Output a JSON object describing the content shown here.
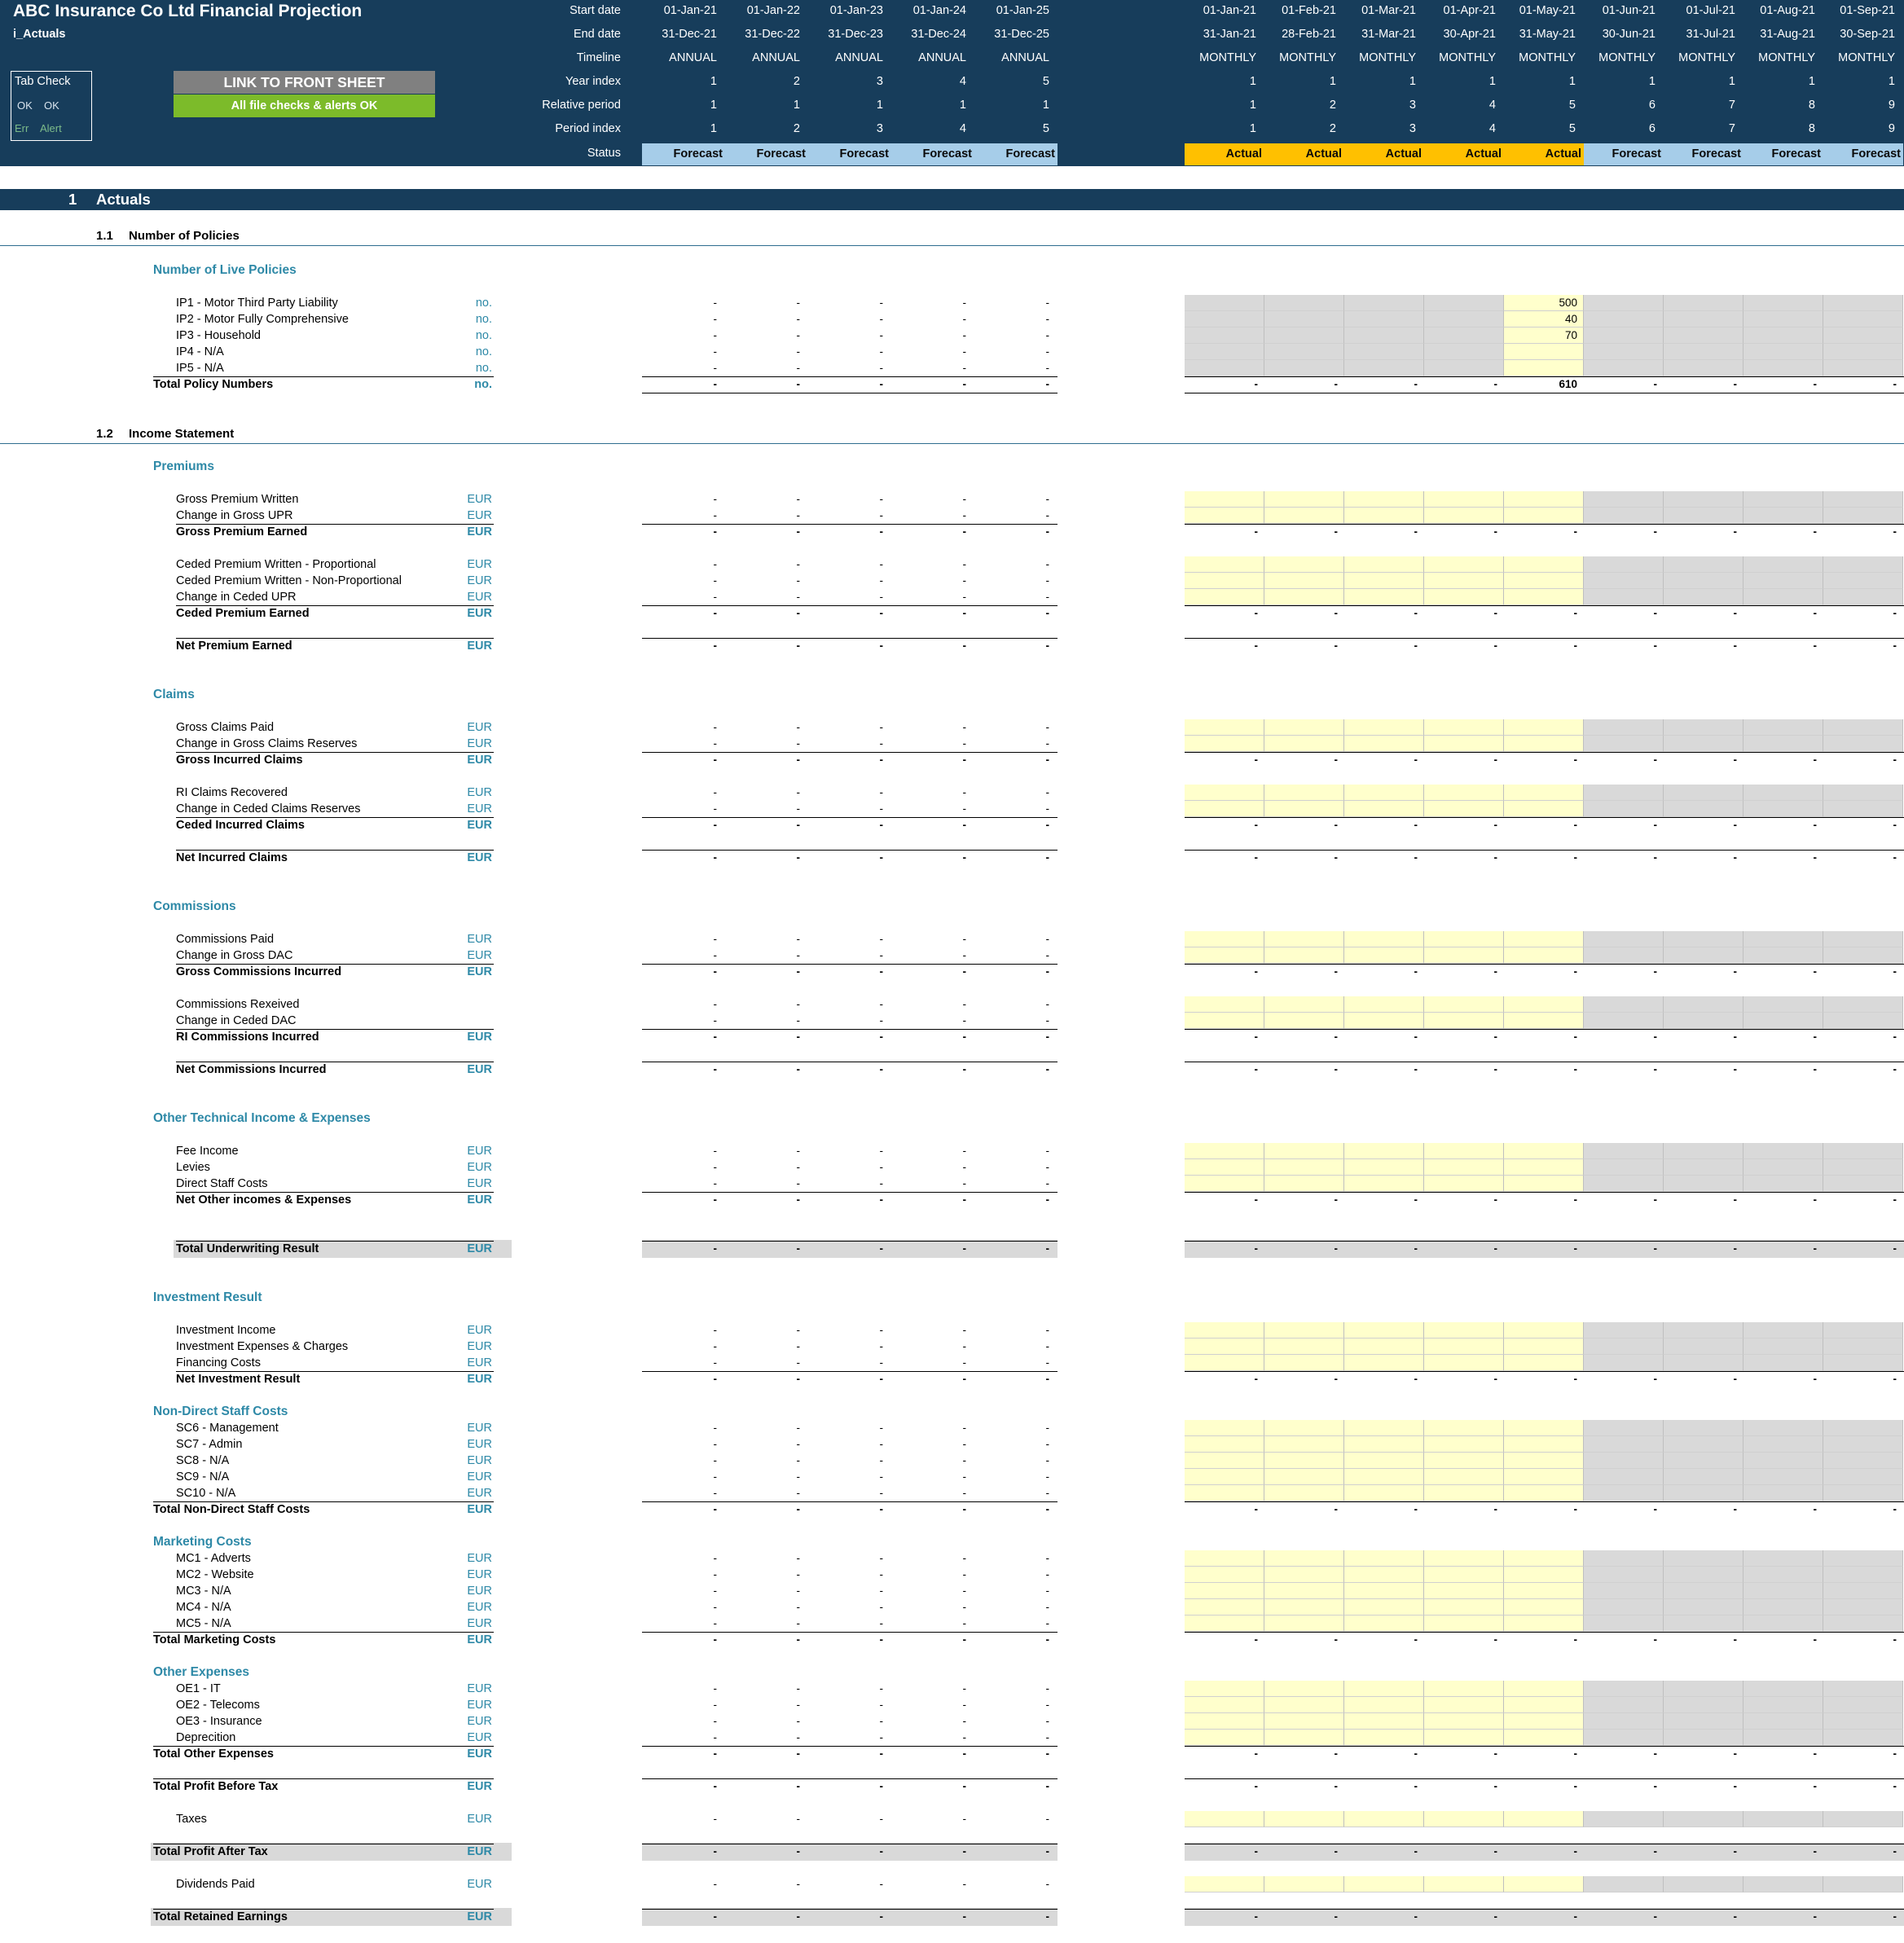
{
  "header": {
    "title": "ABC Insurance Co Ltd Financial Projection",
    "tab_name": "i_Actuals",
    "row_labels": [
      "Start date",
      "End date",
      "Timeline",
      "Year index",
      "Relative period",
      "Period index",
      "Status"
    ],
    "tab_check": {
      "title": "Tab Check",
      "ok_1": "OK",
      "ok_2": "OK",
      "err": "Err",
      "alert": "Alert"
    },
    "link_button": "LINK TO FRONT SHEET",
    "check_banner": "All file checks & alerts OK",
    "annual_columns": [
      {
        "start": "01-Jan-21",
        "end": "31-Dec-21",
        "timeline": "ANNUAL",
        "year": "1",
        "rel": "1",
        "period": "1",
        "status": "Forecast"
      },
      {
        "start": "01-Jan-22",
        "end": "31-Dec-22",
        "timeline": "ANNUAL",
        "year": "2",
        "rel": "1",
        "period": "2",
        "status": "Forecast"
      },
      {
        "start": "01-Jan-23",
        "end": "31-Dec-23",
        "timeline": "ANNUAL",
        "year": "3",
        "rel": "1",
        "period": "3",
        "status": "Forecast"
      },
      {
        "start": "01-Jan-24",
        "end": "31-Dec-24",
        "timeline": "ANNUAL",
        "year": "4",
        "rel": "1",
        "period": "4",
        "status": "Forecast"
      },
      {
        "start": "01-Jan-25",
        "end": "31-Dec-25",
        "timeline": "ANNUAL",
        "year": "5",
        "rel": "1",
        "period": "5",
        "status": "Forecast"
      }
    ],
    "monthly_columns": [
      {
        "start": "01-Jan-21",
        "end": "31-Jan-21",
        "timeline": "MONTHLY",
        "year": "1",
        "rel": "1",
        "period": "1",
        "status": "Actual"
      },
      {
        "start": "01-Feb-21",
        "end": "28-Feb-21",
        "timeline": "MONTHLY",
        "year": "1",
        "rel": "2",
        "period": "2",
        "status": "Actual"
      },
      {
        "start": "01-Mar-21",
        "end": "31-Mar-21",
        "timeline": "MONTHLY",
        "year": "1",
        "rel": "3",
        "period": "3",
        "status": "Actual"
      },
      {
        "start": "01-Apr-21",
        "end": "30-Apr-21",
        "timeline": "MONTHLY",
        "year": "1",
        "rel": "4",
        "period": "4",
        "status": "Actual"
      },
      {
        "start": "01-May-21",
        "end": "31-May-21",
        "timeline": "MONTHLY",
        "year": "1",
        "rel": "5",
        "period": "5",
        "status": "Actual"
      },
      {
        "start": "01-Jun-21",
        "end": "30-Jun-21",
        "timeline": "MONTHLY",
        "year": "1",
        "rel": "6",
        "period": "6",
        "status": "Forecast"
      },
      {
        "start": "01-Jul-21",
        "end": "31-Jul-21",
        "timeline": "MONTHLY",
        "year": "1",
        "rel": "7",
        "period": "7",
        "status": "Forecast"
      },
      {
        "start": "01-Aug-21",
        "end": "31-Aug-21",
        "timeline": "MONTHLY",
        "year": "1",
        "rel": "8",
        "period": "8",
        "status": "Forecast"
      },
      {
        "start": "01-Sep-21",
        "end": "30-Sep-21",
        "timeline": "MONTHLY",
        "year": "1",
        "rel": "9",
        "period": "9",
        "status": "Forecast"
      }
    ]
  },
  "section_1": {
    "number": "1",
    "title": "Actuals"
  },
  "subsection_1_1": {
    "number": "1.1",
    "title": "Number of Policies"
  },
  "subsection_1_2": {
    "number": "1.2",
    "title": "Income Statement"
  },
  "dash": "-",
  "rows": [
    {
      "kind": "group",
      "label": "Number of Live Policies"
    },
    {
      "kind": "input",
      "label": "IP1 - Motor Third Party Liability",
      "unit": "no.",
      "input": "grey",
      "values": [
        "",
        "",
        "",
        "",
        "500",
        "",
        "",
        "",
        ""
      ]
    },
    {
      "kind": "input",
      "label": "IP2 - Motor Fully Comprehensive",
      "unit": "no.",
      "input": "grey",
      "values": [
        "",
        "",
        "",
        "",
        "40",
        "",
        "",
        "",
        ""
      ]
    },
    {
      "kind": "input",
      "label": "IP3 - Household",
      "unit": "no.",
      "input": "grey",
      "values": [
        "",
        "",
        "",
        "",
        "70",
        "",
        "",
        "",
        ""
      ]
    },
    {
      "kind": "input",
      "label": "IP4 - N/A",
      "unit": "no.",
      "input": "grey",
      "values": [
        "",
        "",
        "",
        "",
        "",
        "",
        "",
        "",
        ""
      ]
    },
    {
      "kind": "input",
      "label": "IP5 - N/A",
      "unit": "no.",
      "input": "grey",
      "values": [
        "",
        "",
        "",
        "",
        "",
        "",
        "",
        "",
        ""
      ]
    },
    {
      "kind": "total",
      "label": "Total Policy Numbers",
      "unit": "no.",
      "values": [
        "-",
        "-",
        "-",
        "-",
        "610",
        "-",
        "-",
        "-",
        "-"
      ]
    },
    {
      "kind": "subsection",
      "ref": "1.2"
    },
    {
      "kind": "group",
      "label": "Premiums"
    },
    {
      "kind": "input",
      "label": "Gross Premium Written",
      "unit": "EUR"
    },
    {
      "kind": "input",
      "label": "Change in Gross UPR",
      "unit": "EUR"
    },
    {
      "kind": "subtotal",
      "label": "Gross Premium Earned",
      "unit": "EUR"
    },
    {
      "kind": "input",
      "label": "Ceded Premium Written - Proportional",
      "unit": "EUR"
    },
    {
      "kind": "input",
      "label": "Ceded Premium Written - Non-Proportional",
      "unit": "EUR"
    },
    {
      "kind": "input",
      "label": "Change in Ceded UPR",
      "unit": "EUR"
    },
    {
      "kind": "subtotal",
      "label": "Ceded Premium Earned",
      "unit": "EUR"
    },
    {
      "kind": "subtotal",
      "label": "Net Premium Earned",
      "unit": "EUR"
    },
    {
      "kind": "group",
      "label": "Claims"
    },
    {
      "kind": "input",
      "label": "Gross Claims Paid",
      "unit": "EUR"
    },
    {
      "kind": "input",
      "label": "Change in Gross Claims Reserves",
      "unit": "EUR"
    },
    {
      "kind": "subtotal",
      "label": "Gross Incurred Claims",
      "unit": "EUR"
    },
    {
      "kind": "input",
      "label": "RI Claims Recovered",
      "unit": "EUR"
    },
    {
      "kind": "input",
      "label": "Change in Ceded Claims Reserves",
      "unit": "EUR"
    },
    {
      "kind": "subtotal",
      "label": "Ceded Incurred Claims",
      "unit": "EUR"
    },
    {
      "kind": "subtotal",
      "label": "Net Incurred Claims",
      "unit": "EUR"
    },
    {
      "kind": "group",
      "label": "Commissions"
    },
    {
      "kind": "input",
      "label": "Commissions Paid",
      "unit": "EUR"
    },
    {
      "kind": "input",
      "label": "Change in Gross DAC",
      "unit": "EUR"
    },
    {
      "kind": "subtotal",
      "label": "Gross Commissions Incurred",
      "unit": "EUR"
    },
    {
      "kind": "input",
      "label": "Commissions Rexeived",
      "unit": ""
    },
    {
      "kind": "input",
      "label": "Change in Ceded DAC",
      "unit": ""
    },
    {
      "kind": "subtotal",
      "label": "RI Commissions Incurred",
      "unit": "EUR"
    },
    {
      "kind": "subtotal",
      "label": "Net Commissions Incurred",
      "unit": "EUR"
    },
    {
      "kind": "group",
      "label": "Other Technical Income & Expenses"
    },
    {
      "kind": "input",
      "label": "Fee Income",
      "unit": "EUR"
    },
    {
      "kind": "input",
      "label": "Levies",
      "unit": "EUR"
    },
    {
      "kind": "input",
      "label": "Direct Staff Costs",
      "unit": "EUR"
    },
    {
      "kind": "subtotal",
      "label": "Net Other incomes & Expenses",
      "unit": "EUR"
    },
    {
      "kind": "grand",
      "label": "Total Underwriting Result",
      "unit": "EUR"
    },
    {
      "kind": "group",
      "label": "Investment Result"
    },
    {
      "kind": "input",
      "label": "Investment Income",
      "unit": "EUR"
    },
    {
      "kind": "input",
      "label": "Investment Expenses & Charges",
      "unit": "EUR"
    },
    {
      "kind": "input",
      "label": "Financing Costs",
      "unit": "EUR"
    },
    {
      "kind": "subtotal",
      "label": "Net Investment Result",
      "unit": "EUR"
    },
    {
      "kind": "group",
      "label": "Non-Direct Staff Costs"
    },
    {
      "kind": "input",
      "label": "SC6 - Management",
      "unit": "EUR"
    },
    {
      "kind": "input",
      "label": "SC7 - Admin",
      "unit": "EUR"
    },
    {
      "kind": "input",
      "label": "SC8 - N/A",
      "unit": "EUR"
    },
    {
      "kind": "input",
      "label": "SC9 - N/A",
      "unit": "EUR"
    },
    {
      "kind": "input",
      "label": "SC10 - N/A",
      "unit": "EUR"
    },
    {
      "kind": "total",
      "label": "Total Non-Direct Staff Costs",
      "unit": "EUR"
    },
    {
      "kind": "group",
      "label": "Marketing Costs"
    },
    {
      "kind": "input",
      "label": "MC1 - Adverts",
      "unit": "EUR"
    },
    {
      "kind": "input",
      "label": "MC2 - Website",
      "unit": "EUR"
    },
    {
      "kind": "input",
      "label": "MC3 - N/A",
      "unit": "EUR"
    },
    {
      "kind": "input",
      "label": "MC4 - N/A",
      "unit": "EUR"
    },
    {
      "kind": "input",
      "label": "MC5 - N/A",
      "unit": "EUR"
    },
    {
      "kind": "total",
      "label": "Total Marketing Costs",
      "unit": "EUR"
    },
    {
      "kind": "group",
      "label": "Other Expenses"
    },
    {
      "kind": "input",
      "label": "OE1 - IT",
      "unit": "EUR"
    },
    {
      "kind": "input",
      "label": "OE2 - Telecoms",
      "unit": "EUR"
    },
    {
      "kind": "input",
      "label": "OE3 - Insurance",
      "unit": "EUR"
    },
    {
      "kind": "input",
      "label": "Deprecition",
      "unit": "EUR"
    },
    {
      "kind": "total",
      "label": "Total Other Expenses",
      "unit": "EUR"
    },
    {
      "kind": "total",
      "label": "Total Profit Before Tax",
      "unit": "EUR"
    },
    {
      "kind": "input",
      "label": "Taxes",
      "unit": "EUR",
      "plain": true
    },
    {
      "kind": "grand",
      "label": "Total Profit After Tax",
      "unit": "EUR"
    },
    {
      "kind": "input",
      "label": "Dividends Paid",
      "unit": "EUR",
      "plain": true
    },
    {
      "kind": "grand",
      "label": "Total Retained Earnings",
      "unit": "EUR"
    }
  ],
  "colors": {
    "header_bg": "#173d5b",
    "forecast": "#a6cde9",
    "actual": "#ffc000",
    "input_yellow": "#ffffcc",
    "input_grey": "#d9d9d9",
    "section_teal": "#2e89a7",
    "link_button": "#808080",
    "ok_banner": "#7cbb2a"
  }
}
